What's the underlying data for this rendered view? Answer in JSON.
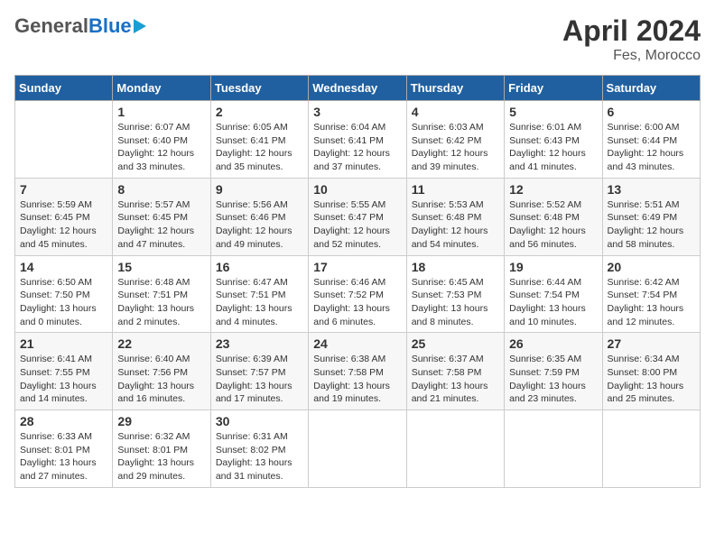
{
  "header": {
    "logo_general": "General",
    "logo_blue": "Blue",
    "month_title": "April 2024",
    "location": "Fes, Morocco"
  },
  "days_of_week": [
    "Sunday",
    "Monday",
    "Tuesday",
    "Wednesday",
    "Thursday",
    "Friday",
    "Saturday"
  ],
  "weeks": [
    [
      {
        "day": "",
        "info": ""
      },
      {
        "day": "1",
        "info": "Sunrise: 6:07 AM\nSunset: 6:40 PM\nDaylight: 12 hours\nand 33 minutes."
      },
      {
        "day": "2",
        "info": "Sunrise: 6:05 AM\nSunset: 6:41 PM\nDaylight: 12 hours\nand 35 minutes."
      },
      {
        "day": "3",
        "info": "Sunrise: 6:04 AM\nSunset: 6:41 PM\nDaylight: 12 hours\nand 37 minutes."
      },
      {
        "day": "4",
        "info": "Sunrise: 6:03 AM\nSunset: 6:42 PM\nDaylight: 12 hours\nand 39 minutes."
      },
      {
        "day": "5",
        "info": "Sunrise: 6:01 AM\nSunset: 6:43 PM\nDaylight: 12 hours\nand 41 minutes."
      },
      {
        "day": "6",
        "info": "Sunrise: 6:00 AM\nSunset: 6:44 PM\nDaylight: 12 hours\nand 43 minutes."
      }
    ],
    [
      {
        "day": "7",
        "info": "Sunrise: 5:59 AM\nSunset: 6:45 PM\nDaylight: 12 hours\nand 45 minutes."
      },
      {
        "day": "8",
        "info": "Sunrise: 5:57 AM\nSunset: 6:45 PM\nDaylight: 12 hours\nand 47 minutes."
      },
      {
        "day": "9",
        "info": "Sunrise: 5:56 AM\nSunset: 6:46 PM\nDaylight: 12 hours\nand 49 minutes."
      },
      {
        "day": "10",
        "info": "Sunrise: 5:55 AM\nSunset: 6:47 PM\nDaylight: 12 hours\nand 52 minutes."
      },
      {
        "day": "11",
        "info": "Sunrise: 5:53 AM\nSunset: 6:48 PM\nDaylight: 12 hours\nand 54 minutes."
      },
      {
        "day": "12",
        "info": "Sunrise: 5:52 AM\nSunset: 6:48 PM\nDaylight: 12 hours\nand 56 minutes."
      },
      {
        "day": "13",
        "info": "Sunrise: 5:51 AM\nSunset: 6:49 PM\nDaylight: 12 hours\nand 58 minutes."
      }
    ],
    [
      {
        "day": "14",
        "info": "Sunrise: 6:50 AM\nSunset: 7:50 PM\nDaylight: 13 hours\nand 0 minutes."
      },
      {
        "day": "15",
        "info": "Sunrise: 6:48 AM\nSunset: 7:51 PM\nDaylight: 13 hours\nand 2 minutes."
      },
      {
        "day": "16",
        "info": "Sunrise: 6:47 AM\nSunset: 7:51 PM\nDaylight: 13 hours\nand 4 minutes."
      },
      {
        "day": "17",
        "info": "Sunrise: 6:46 AM\nSunset: 7:52 PM\nDaylight: 13 hours\nand 6 minutes."
      },
      {
        "day": "18",
        "info": "Sunrise: 6:45 AM\nSunset: 7:53 PM\nDaylight: 13 hours\nand 8 minutes."
      },
      {
        "day": "19",
        "info": "Sunrise: 6:44 AM\nSunset: 7:54 PM\nDaylight: 13 hours\nand 10 minutes."
      },
      {
        "day": "20",
        "info": "Sunrise: 6:42 AM\nSunset: 7:54 PM\nDaylight: 13 hours\nand 12 minutes."
      }
    ],
    [
      {
        "day": "21",
        "info": "Sunrise: 6:41 AM\nSunset: 7:55 PM\nDaylight: 13 hours\nand 14 minutes."
      },
      {
        "day": "22",
        "info": "Sunrise: 6:40 AM\nSunset: 7:56 PM\nDaylight: 13 hours\nand 16 minutes."
      },
      {
        "day": "23",
        "info": "Sunrise: 6:39 AM\nSunset: 7:57 PM\nDaylight: 13 hours\nand 17 minutes."
      },
      {
        "day": "24",
        "info": "Sunrise: 6:38 AM\nSunset: 7:58 PM\nDaylight: 13 hours\nand 19 minutes."
      },
      {
        "day": "25",
        "info": "Sunrise: 6:37 AM\nSunset: 7:58 PM\nDaylight: 13 hours\nand 21 minutes."
      },
      {
        "day": "26",
        "info": "Sunrise: 6:35 AM\nSunset: 7:59 PM\nDaylight: 13 hours\nand 23 minutes."
      },
      {
        "day": "27",
        "info": "Sunrise: 6:34 AM\nSunset: 8:00 PM\nDaylight: 13 hours\nand 25 minutes."
      }
    ],
    [
      {
        "day": "28",
        "info": "Sunrise: 6:33 AM\nSunset: 8:01 PM\nDaylight: 13 hours\nand 27 minutes."
      },
      {
        "day": "29",
        "info": "Sunrise: 6:32 AM\nSunset: 8:01 PM\nDaylight: 13 hours\nand 29 minutes."
      },
      {
        "day": "30",
        "info": "Sunrise: 6:31 AM\nSunset: 8:02 PM\nDaylight: 13 hours\nand 31 minutes."
      },
      {
        "day": "",
        "info": ""
      },
      {
        "day": "",
        "info": ""
      },
      {
        "day": "",
        "info": ""
      },
      {
        "day": "",
        "info": ""
      }
    ]
  ]
}
